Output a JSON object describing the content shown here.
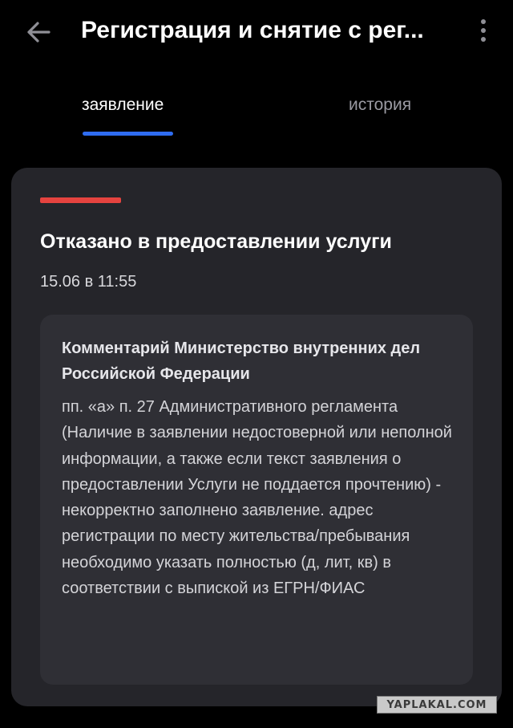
{
  "app_bar": {
    "title": "Регистрация и снятие с рег...",
    "back_icon": "arrow-left-icon",
    "more_icon": "more-vertical-icon"
  },
  "tabs": [
    {
      "label": "заявление",
      "active": true
    },
    {
      "label": "история",
      "active": false
    }
  ],
  "status": {
    "title": "Отказано в предоставлении услуги",
    "date": "15.06 в 11:55",
    "color": "#e5433f"
  },
  "comment": {
    "author": "Комментарий Министерство внутренних дел Российской Федерации",
    "text": "пп. «а» п. 27 Административного регламента (Наличие в заявлении недостоверной или неполной информации, а также если текст заявления о предоставлении Услуги не поддается прочтению) - некорректно заполнено заявление. адрес регистрации по месту жительства/пребывания необходимо указать полностью (д, лит, кв) в соответствии с выпиской из ЕГРН/ФИАС"
  },
  "watermark": "YAPLAKAL.COM",
  "colors": {
    "background": "#000000",
    "card": "#25252a",
    "comment_box": "#2f2f35",
    "accent": "#2f6df2",
    "inactive_tab": "#9a9aa2"
  }
}
